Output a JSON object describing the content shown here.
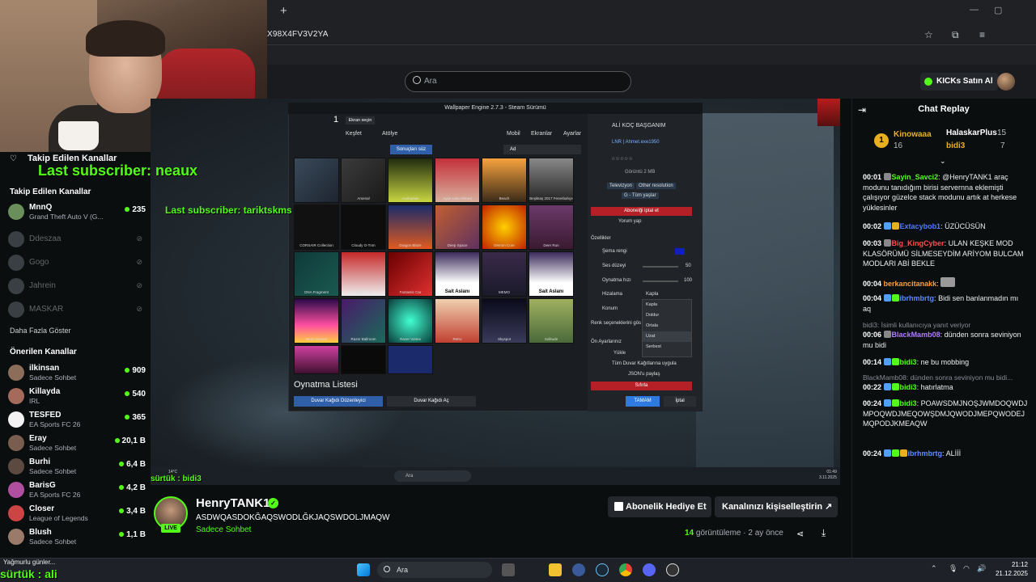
{
  "browser": {
    "url": "X98X4FV3V2YA",
    "new_tab": "+"
  },
  "header": {
    "search_placeholder": "Ara",
    "kicks_button": "KICKs Satın Al"
  },
  "overlays": {
    "last_sub_big": "Last subscriber: neaux",
    "last_sub_small": "Last subscriber: tariktskms",
    "surtuk_player": "sürtük : bidi3",
    "surtuk_bottom": "sürtük : ali",
    "rain_notice": "Yağmurlu günler..."
  },
  "sidebar": {
    "title": "Takip Edilen Kanallar",
    "followed_header": "Takip Edilen Kanallar",
    "followed": [
      {
        "name": "MnnQ",
        "category": "Grand Theft Auto V (G...",
        "viewers": "235",
        "live": true
      },
      {
        "name": "Ddeszaa",
        "live": false
      },
      {
        "name": "Gogo",
        "live": false
      },
      {
        "name": "Jahrein",
        "live": false
      },
      {
        "name": "MASKAR",
        "live": false
      }
    ],
    "show_more": "Daha Fazla Göster",
    "recommended_header": "Önerilen Kanallar",
    "recommended": [
      {
        "name": "ilkinsan",
        "category": "Sadece Sohbet",
        "viewers": "909"
      },
      {
        "name": "Killayda",
        "category": "IRL",
        "viewers": "540"
      },
      {
        "name": "TESFED",
        "category": "EA Sports FC 26",
        "viewers": "365"
      },
      {
        "name": "Eray",
        "category": "Sadece Sohbet",
        "viewers": "20,1 B"
      },
      {
        "name": "Burhi",
        "category": "Sadece Sohbet",
        "viewers": "6,4 B"
      },
      {
        "name": "BarisG",
        "category": "EA Sports FC 26",
        "viewers": "4,2 B"
      },
      {
        "name": "Closer",
        "category": "League of Legends",
        "viewers": "3,4 B"
      },
      {
        "name": "Blush",
        "category": "Sadece Sohbet",
        "viewers": "1,1 B"
      }
    ]
  },
  "wallpaper_engine": {
    "title": "Wallpaper Engine 2.7.3 - Steam Sürümü",
    "screen_num": "1",
    "screen_select": "Ekran seçin",
    "discover": "Keşfet",
    "workshop": "Atölye",
    "mobile": "Mobil",
    "screens": "Ekranlar",
    "settings": "Ayarlar",
    "filter": "Sonuçları süz",
    "sort": "Ad",
    "tiles": [
      "",
      "Arsenal",
      "Audiophile",
      "Ayşe Uslu Ahmed",
      "Beach",
      "Beşiktaş 2017 Fenerbahçe",
      "CORSAIR Collection",
      "Cloudy O-Tnm",
      "Dragon Blaze",
      "Deep Space",
      "Demon Core",
      "Deer Run",
      "DNA Fragment",
      "Eagle Flag",
      "Fantastic Car",
      "Sait Aslanı",
      "MEMO",
      "Sait Aslanı",
      "Neon Sunset",
      "Razer Ballroom",
      "Razer Vortex",
      "Retro",
      "Skyspot",
      "Solitude"
    ],
    "playlist": "Oynatma Listesi",
    "edit_btn": "Duvar Kağıdı Düzenleyici",
    "open_btn": "Duvar Kağıdı Aç",
    "side_title": "ALİ KOÇ BAŞGANIM",
    "side_author": "LNR | Ahmet.exe1950",
    "views": "Görüntü 2 MB",
    "tags": [
      "Televizyon",
      "Other resolution",
      "G - Tüm yaşlar"
    ],
    "unsubscribe": "Abonelği iptal et",
    "comment": "Yorum yap",
    "properties": "Özellikler",
    "scheme": "Şema rengi",
    "volume": "Ses düzeyi",
    "volume_val": "50",
    "speed": "Oynatma hızı",
    "speed_val": "100",
    "align": "Hizalama",
    "align_val": "Kapla",
    "position": "Konum",
    "color_text": "Renk seçeneklerini gös",
    "presets": "Ön Ayarlarınız",
    "load": "Yükle",
    "apply_all": "Tüm Duvar Kağıtlarına uygula",
    "share_json": "JSON'u paylaş",
    "reset": "Sıfırla",
    "ok": "TAMAM",
    "cancel": "İptal",
    "dropdown": [
      "Kapla",
      "Doldur",
      "Ortala",
      "Uzat",
      "Serbest"
    ]
  },
  "inner_taskbar": {
    "search": "Ara",
    "time": "01:49",
    "date": "3.11.2025",
    "weather": "14°C"
  },
  "stream": {
    "streamer": "HenryTANK1",
    "live_label": "LIVE",
    "title": "ASDWQASDOKĞAQSWODLĞKJAQSWDOLJMAQW",
    "category": "Sadece Sohbet",
    "gift_button": "Abonelik Hediye Et",
    "customize_button": "Kanalınızı kişiselleştirin",
    "views_count": "14",
    "views_label": "görüntüleme",
    "age": "2 ay önce"
  },
  "chat": {
    "title": "Chat Replay",
    "leaderboard": [
      {
        "rank": "1",
        "name": "Kinowaaa",
        "count": "16"
      },
      {
        "name": "HalaskarPlus",
        "count": "15"
      },
      {
        "name": "bidi3",
        "count": "7"
      }
    ],
    "messages": [
      {
        "time": "00:01",
        "user": "Sayin_Savci2",
        "color": "#53fc18",
        "text": "@HenryTANK1 araç modunu tanıdığım birisi servernna eklemişti çalışıyor güzelce stack modunu artık at herkese yüklesinler"
      },
      {
        "time": "00:02",
        "user": "Extacybob1",
        "color": "#4f7bff",
        "text": "ÜZÜCÜSÜN"
      },
      {
        "time": "00:03",
        "user": "Big_KingCyber",
        "color": "#ff4d4d",
        "text": "ULAN KEŞKE MOD KLASÖRÜMÜ SİLMESEYDİM ARİYOM BULCAM MODLARI ABİ BEKLE"
      },
      {
        "time": "00:04",
        "user": "berkancitanakk",
        "color": "#ff9d3a",
        "text": ""
      },
      {
        "time": "00:04",
        "user": "ibrhmbrtg",
        "color": "#5b8cff",
        "text": "Bidi sen banlanmadın mı aq"
      },
      {
        "reply": "bidi3: İsimli kullanıcıya yanıt veriyor"
      },
      {
        "time": "00:06",
        "user": "BlackMamb08",
        "color": "#b07cff",
        "text": "dünden sonra seviniyon mu bidi"
      },
      {
        "time": "00:14",
        "user": "bidi3",
        "color": "#53fc18",
        "text": "ne bu mobbing"
      },
      {
        "reply": "BlackMamb08: dünden sonra seviniyon mu bidi..."
      },
      {
        "time": "00:22",
        "user": "bidi3",
        "color": "#53fc18",
        "text": "hatırlatma"
      },
      {
        "time": "00:24",
        "user": "bidi3",
        "color": "#53fc18",
        "text": "POAWSDMJNOŞJWMDOQWDJMPOQWDJMEQOWŞDMJQWODJMEPQWODEJMQPODJKMEAQW"
      },
      {
        "time": "00:24",
        "user": "ibrhmbrtg",
        "color": "#5b8cff",
        "text": "ALİİİ"
      }
    ]
  },
  "taskbar": {
    "search": "Ara",
    "time": "21:12",
    "date": "21.12.2025"
  },
  "colors": {
    "kick_green": "#53fc18",
    "bg": "#0b0e0f"
  }
}
